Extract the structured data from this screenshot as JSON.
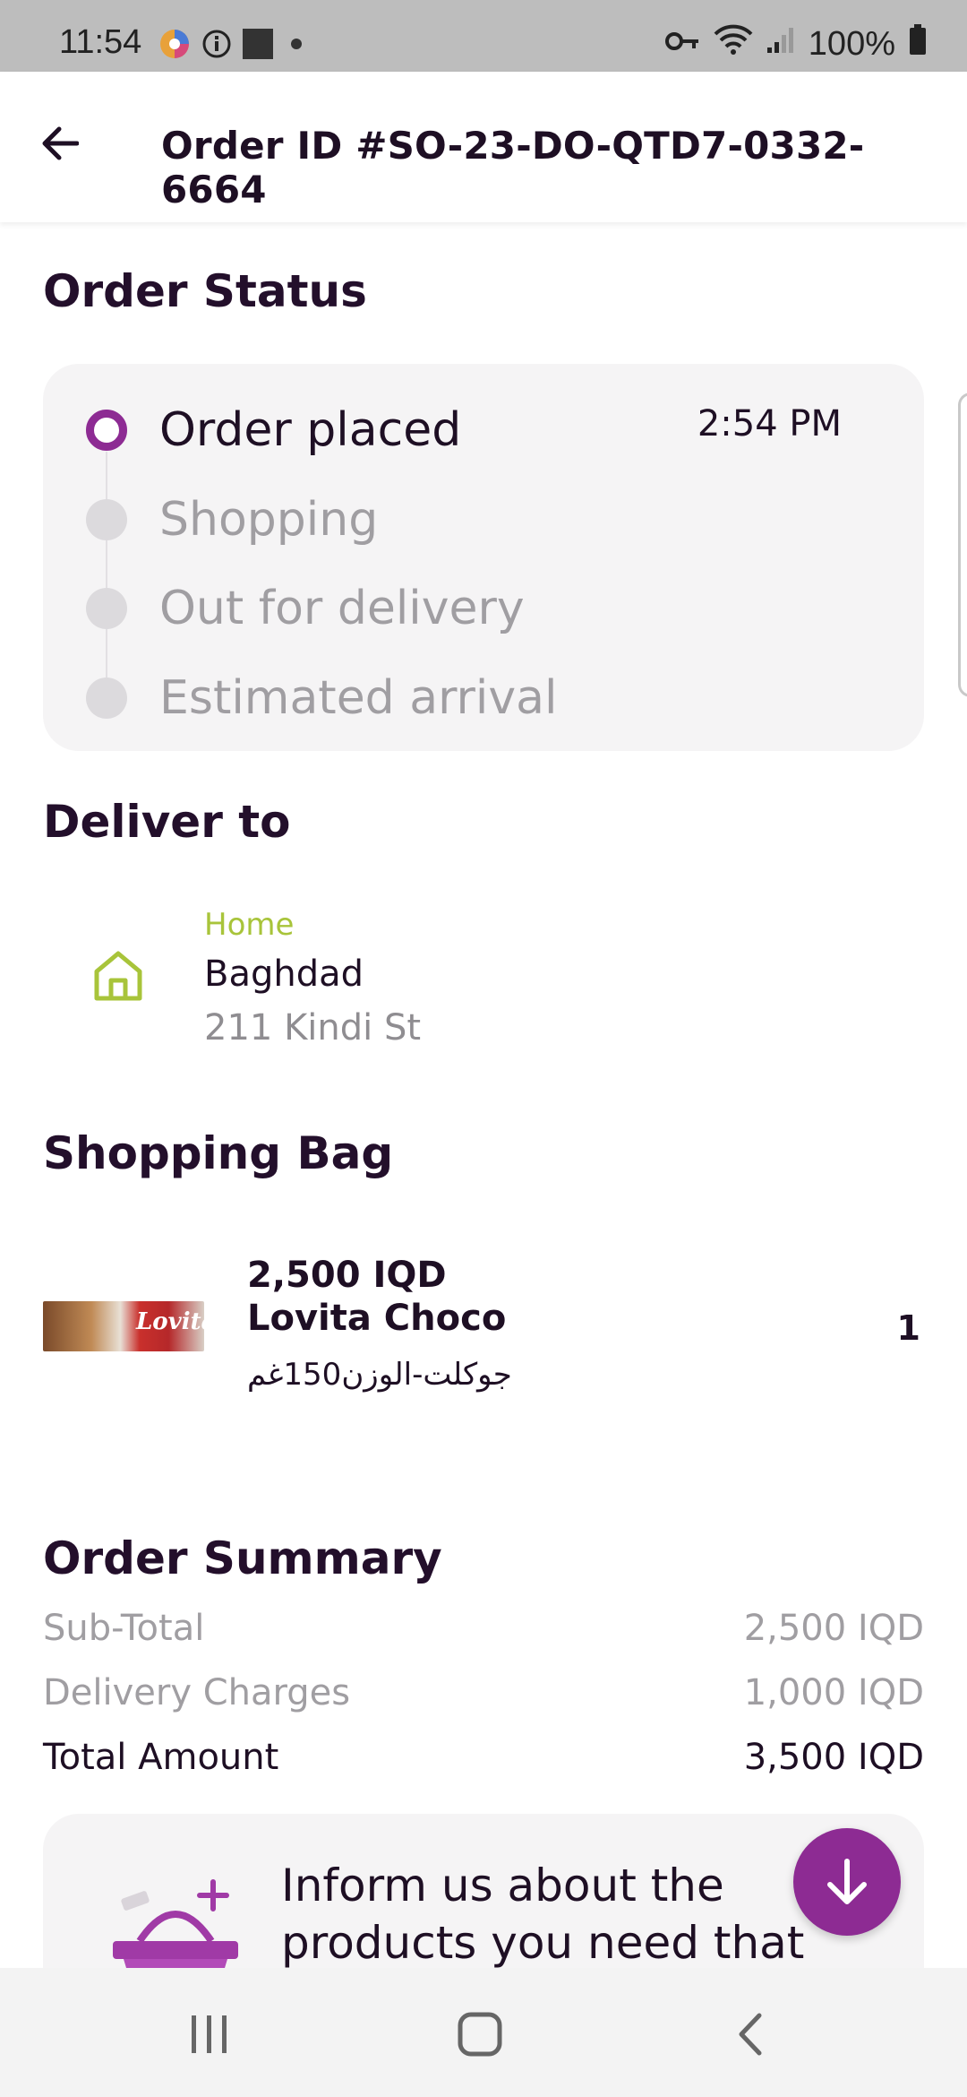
{
  "status_bar": {
    "time": "11:54",
    "battery": "100%"
  },
  "app_bar": {
    "title": "Order ID #SO-23-DO-QTD7-0332-6664"
  },
  "order_status": {
    "title": "Order Status",
    "steps": [
      {
        "label": "Order placed",
        "time": "2:54 PM",
        "active": true
      },
      {
        "label": "Shopping",
        "time": "",
        "active": false
      },
      {
        "label": "Out for delivery",
        "time": "",
        "active": false
      },
      {
        "label": "Estimated arrival",
        "time": "",
        "active": false
      }
    ]
  },
  "deliver_to": {
    "title": "Deliver to",
    "label": "Home",
    "city": "Baghdad",
    "street": "211 Kindi St"
  },
  "shopping_bag": {
    "title": "Shopping Bag",
    "items": [
      {
        "image_text": "Lovita",
        "price": "2,500 IQD",
        "name": "Lovita Choco",
        "description": "جوكلت-الوزن150غم",
        "quantity": "1"
      }
    ]
  },
  "order_summary": {
    "title": "Order Summary",
    "subtotal_label": "Sub-Total",
    "subtotal_value": "2,500 IQD",
    "delivery_label": "Delivery Charges",
    "delivery_value": "1,000 IQD",
    "total_label": "Total Amount",
    "total_value": "3,500 IQD"
  },
  "inform_card": {
    "text": "Inform us about the products you need that"
  },
  "colors": {
    "accent": "#8d2b93",
    "home_green": "#a8c43a",
    "inactive_dot": "#dcdadd"
  },
  "icons": {
    "back": "arrow-left-icon",
    "home": "home-icon",
    "fab": "arrow-down-icon",
    "basket": "shopping-basket-icon"
  }
}
